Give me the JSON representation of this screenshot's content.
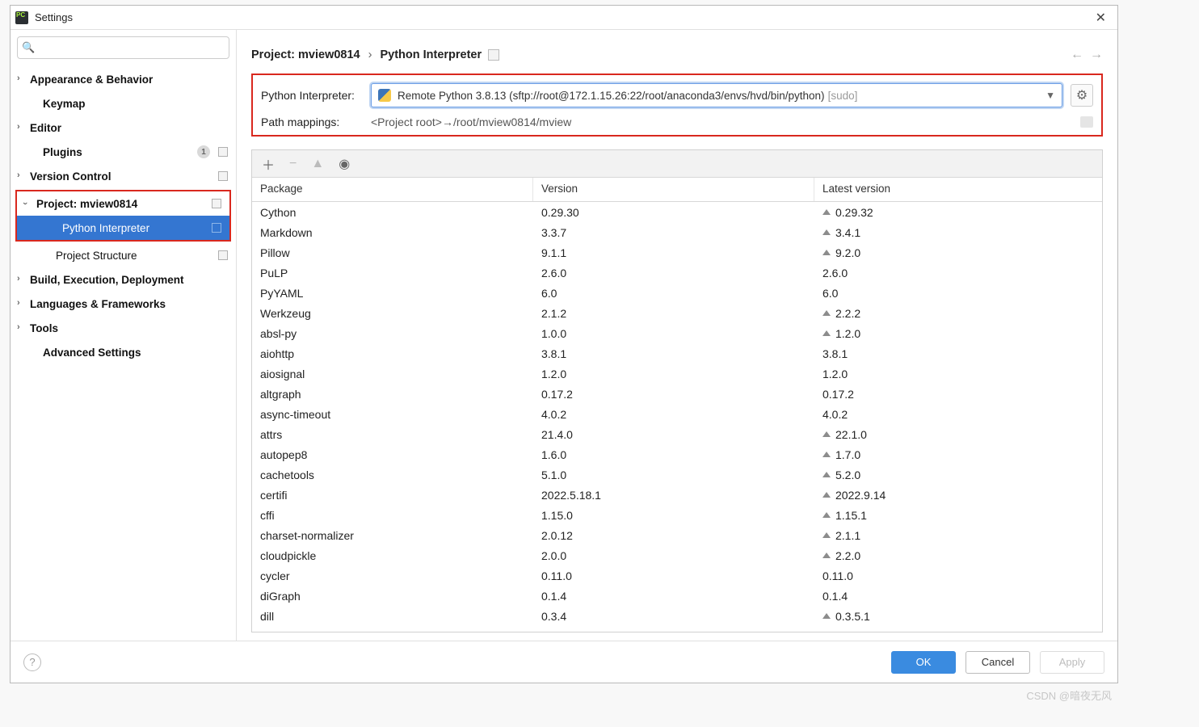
{
  "window": {
    "title": "Settings"
  },
  "sidebar": {
    "search_placeholder": "",
    "items": {
      "appearance": "Appearance & Behavior",
      "keymap": "Keymap",
      "editor": "Editor",
      "plugins": "Plugins",
      "plugins_badge": "1",
      "vcs": "Version Control",
      "project": "Project: mview0814",
      "python_interp": "Python Interpreter",
      "proj_struct": "Project Structure",
      "build": "Build, Execution, Deployment",
      "lang": "Languages & Frameworks",
      "tools": "Tools",
      "advanced": "Advanced Settings"
    }
  },
  "breadcrumb": {
    "a": "Project: mview0814",
    "b": "Python Interpreter"
  },
  "interp": {
    "label": "Python Interpreter:",
    "value": "Remote Python 3.8.13 (sftp://root@172.1.15.26:22/root/anaconda3/envs/hvd/bin/python)",
    "suffix": "[sudo]",
    "path_label": "Path mappings:",
    "path_value": "<Project root>→/root/mview0814/mview"
  },
  "table": {
    "headers": {
      "pkg": "Package",
      "ver": "Version",
      "lat": "Latest version"
    },
    "rows": [
      {
        "p": "Cython",
        "v": "0.29.30",
        "l": "0.29.32",
        "up": true
      },
      {
        "p": "Markdown",
        "v": "3.3.7",
        "l": "3.4.1",
        "up": true
      },
      {
        "p": "Pillow",
        "v": "9.1.1",
        "l": "9.2.0",
        "up": true
      },
      {
        "p": "PuLP",
        "v": "2.6.0",
        "l": "2.6.0",
        "up": false
      },
      {
        "p": "PyYAML",
        "v": "6.0",
        "l": "6.0",
        "up": false
      },
      {
        "p": "Werkzeug",
        "v": "2.1.2",
        "l": "2.2.2",
        "up": true
      },
      {
        "p": "absl-py",
        "v": "1.0.0",
        "l": "1.2.0",
        "up": true
      },
      {
        "p": "aiohttp",
        "v": "3.8.1",
        "l": "3.8.1",
        "up": false
      },
      {
        "p": "aiosignal",
        "v": "1.2.0",
        "l": "1.2.0",
        "up": false
      },
      {
        "p": "altgraph",
        "v": "0.17.2",
        "l": "0.17.2",
        "up": false
      },
      {
        "p": "async-timeout",
        "v": "4.0.2",
        "l": "4.0.2",
        "up": false
      },
      {
        "p": "attrs",
        "v": "21.4.0",
        "l": "22.1.0",
        "up": true
      },
      {
        "p": "autopep8",
        "v": "1.6.0",
        "l": "1.7.0",
        "up": true
      },
      {
        "p": "cachetools",
        "v": "5.1.0",
        "l": "5.2.0",
        "up": true
      },
      {
        "p": "certifi",
        "v": "2022.5.18.1",
        "l": "2022.9.14",
        "up": true
      },
      {
        "p": "cffi",
        "v": "1.15.0",
        "l": "1.15.1",
        "up": true
      },
      {
        "p": "charset-normalizer",
        "v": "2.0.12",
        "l": "2.1.1",
        "up": true
      },
      {
        "p": "cloudpickle",
        "v": "2.0.0",
        "l": "2.2.0",
        "up": true
      },
      {
        "p": "cycler",
        "v": "0.11.0",
        "l": "0.11.0",
        "up": false
      },
      {
        "p": "diGraph",
        "v": "0.1.4",
        "l": "0.1.4",
        "up": false
      },
      {
        "p": "dill",
        "v": "0.3.4",
        "l": "0.3.5.1",
        "up": true
      }
    ]
  },
  "footer": {
    "ok": "OK",
    "cancel": "Cancel",
    "apply": "Apply"
  },
  "watermark": "CSDN @暗夜无风"
}
